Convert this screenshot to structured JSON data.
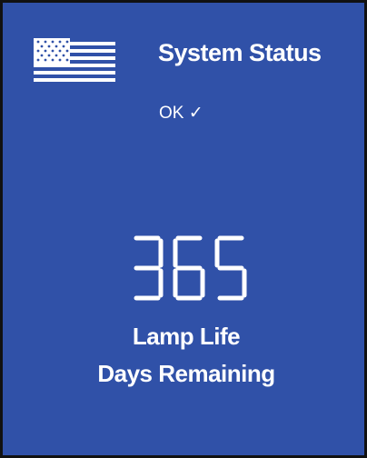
{
  "header": {
    "flag_icon": "us-flag-icon",
    "title": "System Status"
  },
  "status": {
    "text": "OK",
    "check_glyph": "✓"
  },
  "lamp": {
    "days": "365",
    "label_line1": "Lamp Life",
    "label_line2": "Days Remaining"
  },
  "colors": {
    "background": "#3051a8",
    "foreground": "#ffffff",
    "border": "#111111"
  }
}
